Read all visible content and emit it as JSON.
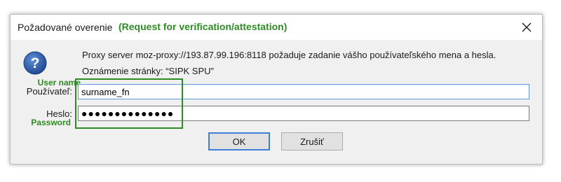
{
  "dialog": {
    "title": "Požadované overenie",
    "title_annotation": "(Request for verification/attestation)",
    "close_symbol": "✕",
    "message_line1": "Proxy server moz-proxy://193.87.99.196:8118 požaduje zadanie vášho používateľského mena a hesla.",
    "message_line2": "Oznámenie stránky: “SIPK SPU”",
    "icon": "question-icon"
  },
  "form": {
    "username_label": "Používateľ:",
    "username_annotation": "User name",
    "username_value": "surname_fn",
    "password_label": "Heslo:",
    "password_annotation": "Password",
    "password_masked": "●●●●●●●●●●●●●●"
  },
  "buttons": {
    "ok_label": "OK",
    "cancel_label": "Zrušiť"
  },
  "colors": {
    "annotation_green": "#2e8b23",
    "focus_blue": "#5a9bd4",
    "help_icon_blue": "#2a5aa8"
  }
}
